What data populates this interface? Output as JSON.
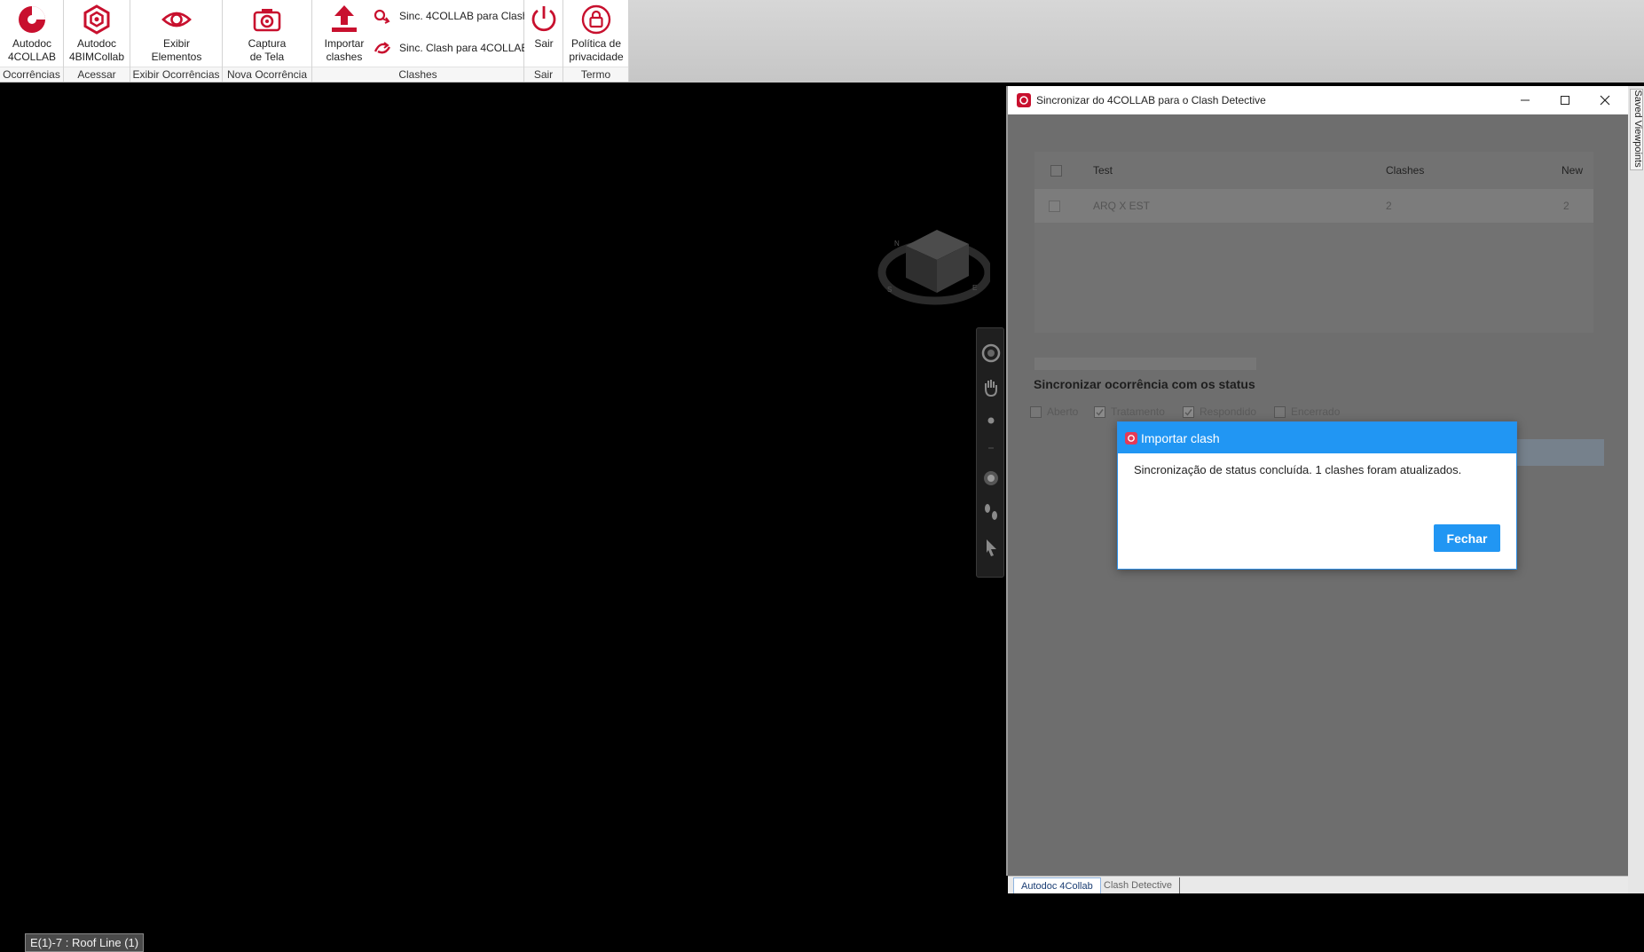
{
  "ribbon": {
    "groups": [
      {
        "label": "Ocorrências",
        "buttons": [
          {
            "label": "Autodoc\n4COLLAB",
            "icon": "autodoc-4collab-logo-icon"
          }
        ]
      },
      {
        "label": "Acessar",
        "buttons": [
          {
            "label": "Autodoc\n4BIMCollab",
            "icon": "autodoc-4bimcollab-logo-icon"
          }
        ]
      },
      {
        "label": "Exibir Ocorrências",
        "buttons": [
          {
            "label": "Exibir\nElementos",
            "icon": "eye-icon"
          }
        ]
      },
      {
        "label": "Nova Ocorrência",
        "buttons": [
          {
            "label": "Captura\nde Tela",
            "icon": "camera-icon"
          }
        ]
      },
      {
        "label": "Clashes",
        "buttons": [
          {
            "label": "Importar\nclashes",
            "icon": "upload-icon"
          },
          {
            "label": "Sinc. 4COLLAB para Clash",
            "icon": "sync-to-clash-icon"
          },
          {
            "label": "Sinc. Clash para 4COLLAB",
            "icon": "sync-to-4collab-icon"
          }
        ]
      },
      {
        "label": "Sair",
        "buttons": [
          {
            "label": "Sair",
            "icon": "power-icon"
          }
        ]
      },
      {
        "label": "Termo",
        "buttons": [
          {
            "label": "Política de\nprivacidade",
            "icon": "lock-icon"
          }
        ]
      }
    ],
    "accent_color": "#c8102e"
  },
  "viewport": {
    "status_label": "E(1)-7 : Roof Line (1)",
    "viewcube_letters": [
      "N",
      "E",
      "S"
    ]
  },
  "panel": {
    "title": "Sincronizar do 4COLLAB para o Clash Detective",
    "table": {
      "columns": [
        "Test",
        "Clashes",
        "New"
      ],
      "rows": [
        {
          "test": "ARQ X EST",
          "clashes": "2",
          "new": "2"
        }
      ]
    },
    "sync_heading": "Sincronizar ocorrência com os status",
    "status_options": [
      {
        "label": "Aberto",
        "checked": false
      },
      {
        "label": "Tratamento",
        "checked": true
      },
      {
        "label": "Respondido",
        "checked": true
      },
      {
        "label": "Encerrado",
        "checked": false
      }
    ],
    "tabs": [
      "Autodoc 4Collab",
      "Clash Detective"
    ]
  },
  "side_tab": "Saved Viewpoints",
  "dialog": {
    "title": "Importar clash",
    "message": "Sincronização de status concluída. 1 clashes foram atualizados.",
    "close_label": "Fechar",
    "accent_color": "#2196f3"
  }
}
